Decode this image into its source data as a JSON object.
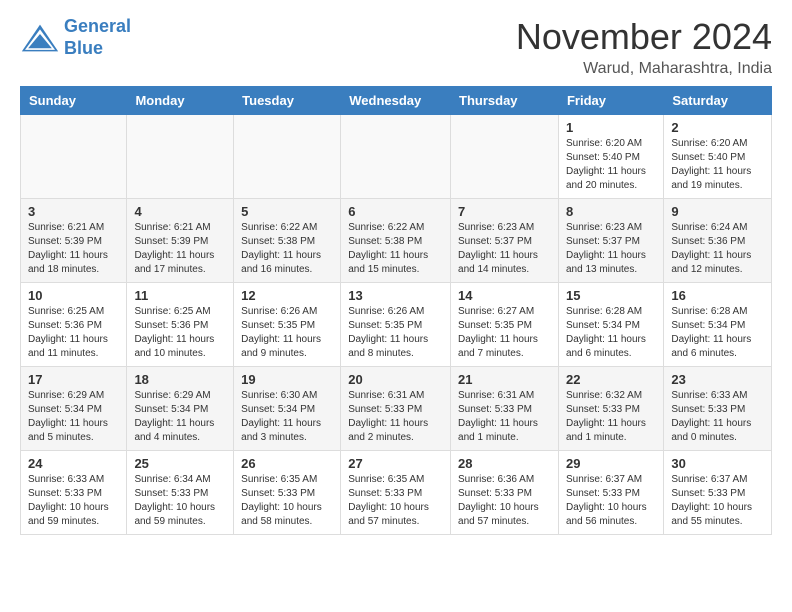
{
  "header": {
    "logo_line1": "General",
    "logo_line2": "Blue",
    "month": "November 2024",
    "location": "Warud, Maharashtra, India"
  },
  "weekdays": [
    "Sunday",
    "Monday",
    "Tuesday",
    "Wednesday",
    "Thursday",
    "Friday",
    "Saturday"
  ],
  "weeks": [
    [
      {
        "day": "",
        "info": ""
      },
      {
        "day": "",
        "info": ""
      },
      {
        "day": "",
        "info": ""
      },
      {
        "day": "",
        "info": ""
      },
      {
        "day": "",
        "info": ""
      },
      {
        "day": "1",
        "info": "Sunrise: 6:20 AM\nSunset: 5:40 PM\nDaylight: 11 hours and 20 minutes."
      },
      {
        "day": "2",
        "info": "Sunrise: 6:20 AM\nSunset: 5:40 PM\nDaylight: 11 hours and 19 minutes."
      }
    ],
    [
      {
        "day": "3",
        "info": "Sunrise: 6:21 AM\nSunset: 5:39 PM\nDaylight: 11 hours and 18 minutes."
      },
      {
        "day": "4",
        "info": "Sunrise: 6:21 AM\nSunset: 5:39 PM\nDaylight: 11 hours and 17 minutes."
      },
      {
        "day": "5",
        "info": "Sunrise: 6:22 AM\nSunset: 5:38 PM\nDaylight: 11 hours and 16 minutes."
      },
      {
        "day": "6",
        "info": "Sunrise: 6:22 AM\nSunset: 5:38 PM\nDaylight: 11 hours and 15 minutes."
      },
      {
        "day": "7",
        "info": "Sunrise: 6:23 AM\nSunset: 5:37 PM\nDaylight: 11 hours and 14 minutes."
      },
      {
        "day": "8",
        "info": "Sunrise: 6:23 AM\nSunset: 5:37 PM\nDaylight: 11 hours and 13 minutes."
      },
      {
        "day": "9",
        "info": "Sunrise: 6:24 AM\nSunset: 5:36 PM\nDaylight: 11 hours and 12 minutes."
      }
    ],
    [
      {
        "day": "10",
        "info": "Sunrise: 6:25 AM\nSunset: 5:36 PM\nDaylight: 11 hours and 11 minutes."
      },
      {
        "day": "11",
        "info": "Sunrise: 6:25 AM\nSunset: 5:36 PM\nDaylight: 11 hours and 10 minutes."
      },
      {
        "day": "12",
        "info": "Sunrise: 6:26 AM\nSunset: 5:35 PM\nDaylight: 11 hours and 9 minutes."
      },
      {
        "day": "13",
        "info": "Sunrise: 6:26 AM\nSunset: 5:35 PM\nDaylight: 11 hours and 8 minutes."
      },
      {
        "day": "14",
        "info": "Sunrise: 6:27 AM\nSunset: 5:35 PM\nDaylight: 11 hours and 7 minutes."
      },
      {
        "day": "15",
        "info": "Sunrise: 6:28 AM\nSunset: 5:34 PM\nDaylight: 11 hours and 6 minutes."
      },
      {
        "day": "16",
        "info": "Sunrise: 6:28 AM\nSunset: 5:34 PM\nDaylight: 11 hours and 6 minutes."
      }
    ],
    [
      {
        "day": "17",
        "info": "Sunrise: 6:29 AM\nSunset: 5:34 PM\nDaylight: 11 hours and 5 minutes."
      },
      {
        "day": "18",
        "info": "Sunrise: 6:29 AM\nSunset: 5:34 PM\nDaylight: 11 hours and 4 minutes."
      },
      {
        "day": "19",
        "info": "Sunrise: 6:30 AM\nSunset: 5:34 PM\nDaylight: 11 hours and 3 minutes."
      },
      {
        "day": "20",
        "info": "Sunrise: 6:31 AM\nSunset: 5:33 PM\nDaylight: 11 hours and 2 minutes."
      },
      {
        "day": "21",
        "info": "Sunrise: 6:31 AM\nSunset: 5:33 PM\nDaylight: 11 hours and 1 minute."
      },
      {
        "day": "22",
        "info": "Sunrise: 6:32 AM\nSunset: 5:33 PM\nDaylight: 11 hours and 1 minute."
      },
      {
        "day": "23",
        "info": "Sunrise: 6:33 AM\nSunset: 5:33 PM\nDaylight: 11 hours and 0 minutes."
      }
    ],
    [
      {
        "day": "24",
        "info": "Sunrise: 6:33 AM\nSunset: 5:33 PM\nDaylight: 10 hours and 59 minutes."
      },
      {
        "day": "25",
        "info": "Sunrise: 6:34 AM\nSunset: 5:33 PM\nDaylight: 10 hours and 59 minutes."
      },
      {
        "day": "26",
        "info": "Sunrise: 6:35 AM\nSunset: 5:33 PM\nDaylight: 10 hours and 58 minutes."
      },
      {
        "day": "27",
        "info": "Sunrise: 6:35 AM\nSunset: 5:33 PM\nDaylight: 10 hours and 57 minutes."
      },
      {
        "day": "28",
        "info": "Sunrise: 6:36 AM\nSunset: 5:33 PM\nDaylight: 10 hours and 57 minutes."
      },
      {
        "day": "29",
        "info": "Sunrise: 6:37 AM\nSunset: 5:33 PM\nDaylight: 10 hours and 56 minutes."
      },
      {
        "day": "30",
        "info": "Sunrise: 6:37 AM\nSunset: 5:33 PM\nDaylight: 10 hours and 55 minutes."
      }
    ]
  ]
}
